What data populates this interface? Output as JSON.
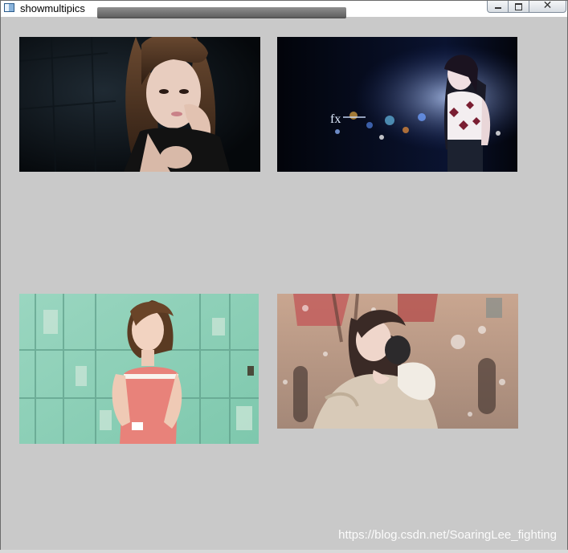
{
  "window": {
    "title": "showmultipics",
    "app_icon": "window-app-icon",
    "buttons": {
      "minimize_icon": "minimize-icon",
      "maximize_icon": "maximize-icon",
      "close_glyph": "✕"
    }
  },
  "images": [
    {
      "name": "dark-portrait-photo"
    },
    {
      "name": "night-city-portrait-photo"
    },
    {
      "name": "teal-wall-portrait-photo"
    },
    {
      "name": "winter-earmuffs-portrait-photo"
    }
  ],
  "watermark": "https://blog.csdn.net/SoaringLee_fighting",
  "colors": {
    "client_background": "#c9c9c9",
    "titlebar_background": "#ffffff"
  }
}
